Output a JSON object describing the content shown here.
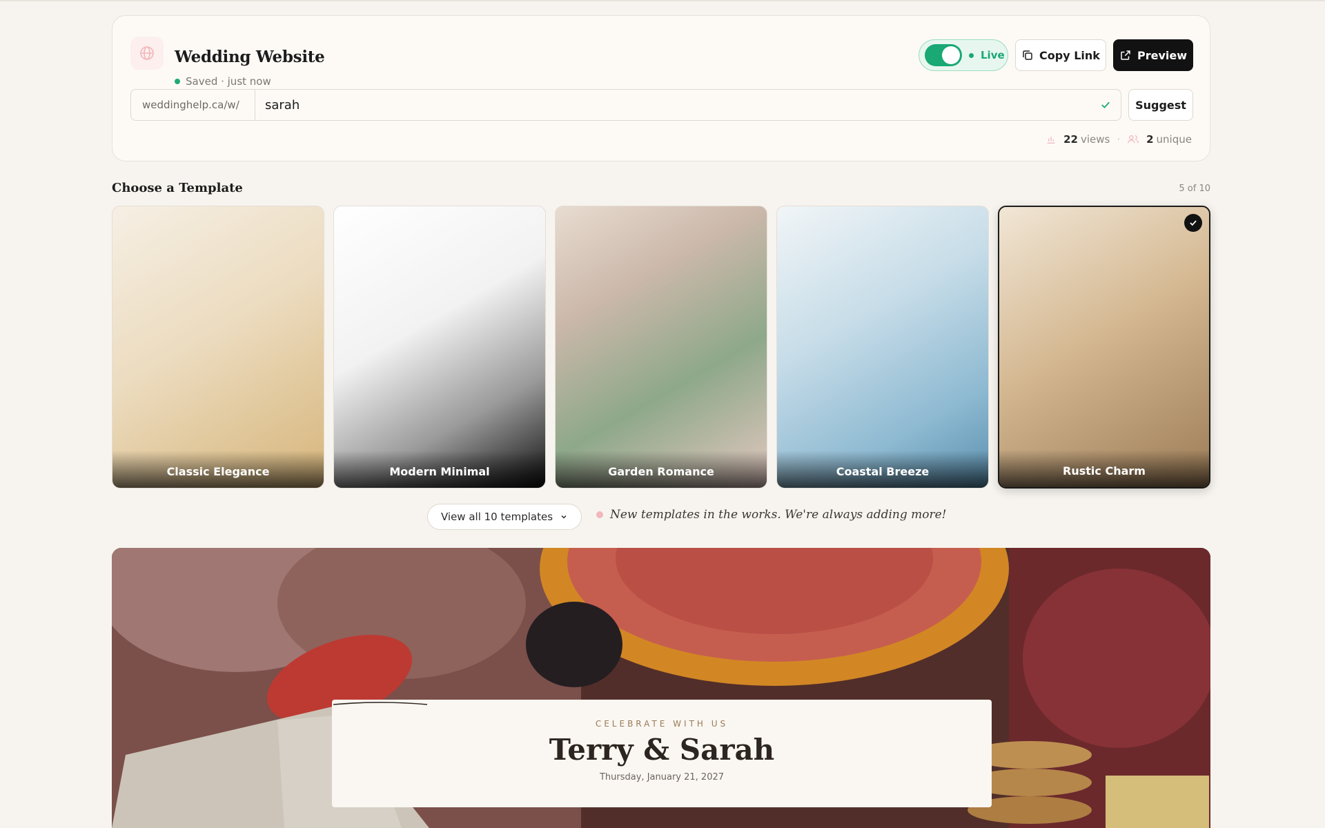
{
  "header": {
    "title": "Wedding Website",
    "saved_status": "Saved · just now",
    "live_label": "Live",
    "copy_link_label": "Copy Link",
    "preview_label": "Preview",
    "url_prefix": "weddinghelp.ca/w/",
    "url_slug": "sarah",
    "suggest_label": "Suggest",
    "views_count": "22",
    "views_label": "views",
    "unique_count": "2",
    "unique_label": "unique"
  },
  "templates": {
    "section_title": "Choose a Template",
    "counter": "5 of 10",
    "items": [
      {
        "name": "Classic Elegance",
        "selected": false
      },
      {
        "name": "Modern Minimal",
        "selected": false
      },
      {
        "name": "Garden Romance",
        "selected": false
      },
      {
        "name": "Coastal Breeze",
        "selected": false
      },
      {
        "name": "Rustic Charm",
        "selected": true
      }
    ],
    "view_all_label": "View all 10 templates",
    "note": "New templates in the works. We're always adding more!"
  },
  "hero": {
    "kicker": "CELEBRATE WITH US",
    "couple": "Terry & Sarah",
    "date": "Thursday, January 21, 2027"
  },
  "colors": {
    "accent_green": "#1aa874",
    "dark_button": "#121212",
    "background": "#f7f4ef"
  }
}
